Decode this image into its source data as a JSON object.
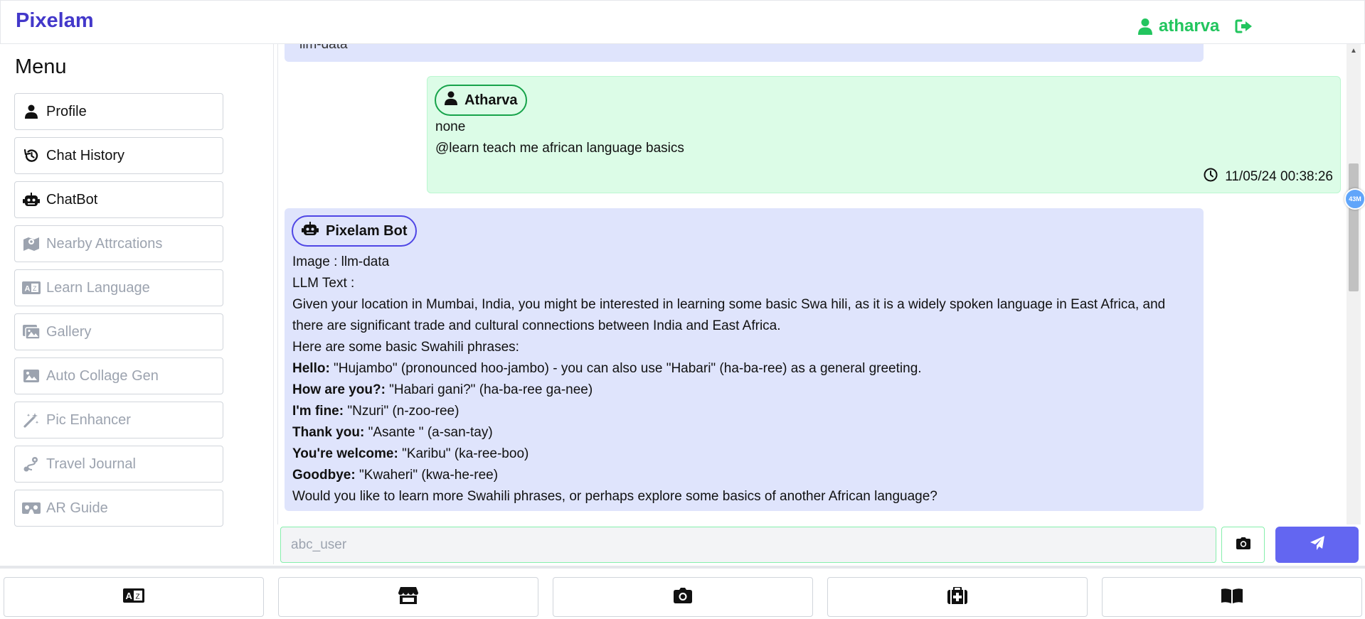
{
  "header": {
    "brand": "Pixelam",
    "username": "atharva",
    "accent_color": "#22c55e",
    "brand_color": "#4338ca"
  },
  "sidebar": {
    "title": "Menu",
    "items": [
      {
        "label": "Profile",
        "icon": "user-icon",
        "enabled": true
      },
      {
        "label": "Chat History",
        "icon": "history-icon",
        "enabled": true
      },
      {
        "label": "ChatBot",
        "icon": "robot-icon",
        "enabled": true
      },
      {
        "label": "Nearby Attrcations",
        "icon": "map-icon",
        "enabled": false
      },
      {
        "label": "Learn Language",
        "icon": "language-icon",
        "enabled": false
      },
      {
        "label": "Gallery",
        "icon": "images-icon",
        "enabled": false
      },
      {
        "label": "Auto Collage Gen",
        "icon": "image-icon",
        "enabled": false
      },
      {
        "label": "Pic Enhancer",
        "icon": "magic-wand-icon",
        "enabled": false
      },
      {
        "label": "Travel Journal",
        "icon": "route-icon",
        "enabled": false
      },
      {
        "label": "AR Guide",
        "icon": "vr-cardboard-icon",
        "enabled": false
      }
    ]
  },
  "chat": {
    "partial_top_text": "llm-data",
    "user_message": {
      "author": "Atharva",
      "line1": "none",
      "line2": "@learn teach me african language basics",
      "timestamp": "11/05/24 00:38:26"
    },
    "bot_message": {
      "author": "Pixelam Bot",
      "image_line": "Image : llm-data",
      "llm_label": "LLM Text :",
      "intro": "Given your location in Mumbai, India, you might be interested in learning some basic Swa hili, as it is a widely spoken language in East Africa, and there are significant trade and cultural connections between India and East Africa.",
      "phrases_heading": "Here are some basic Swahili phrases:",
      "phrases": [
        {
          "term": "Hello:",
          "text": " \"Hujambo\" (pronounced hoo-jambo) - you can also use \"Habari\" (ha-ba-ree) as a general greeting."
        },
        {
          "term": "How are you?:",
          "text": " \"Habari gani?\" (ha-ba-ree ga-nee)"
        },
        {
          "term": "I'm fine:",
          "text": " \"Nzuri\" (n-zoo-ree)"
        },
        {
          "term": "Thank you:",
          "text": " \"Asante \" (a-san-tay)"
        },
        {
          "term": "You're welcome:",
          "text": " \"Karibu\" (ka-ree-boo)"
        },
        {
          "term": "Goodbye:",
          "text": " \"Kwaheri\" (kwa-he-ree)"
        }
      ],
      "closing": "Would you like to learn more Swahili phrases, or perhaps explore some basics of another African language?"
    }
  },
  "floating_badge": "43M",
  "input": {
    "placeholder": "abc_user",
    "send_color": "#6366f1"
  },
  "bottom_nav": [
    {
      "icon": "language-icon"
    },
    {
      "icon": "store-icon"
    },
    {
      "icon": "camera-icon"
    },
    {
      "icon": "medkit-icon"
    },
    {
      "icon": "book-open-icon"
    }
  ]
}
